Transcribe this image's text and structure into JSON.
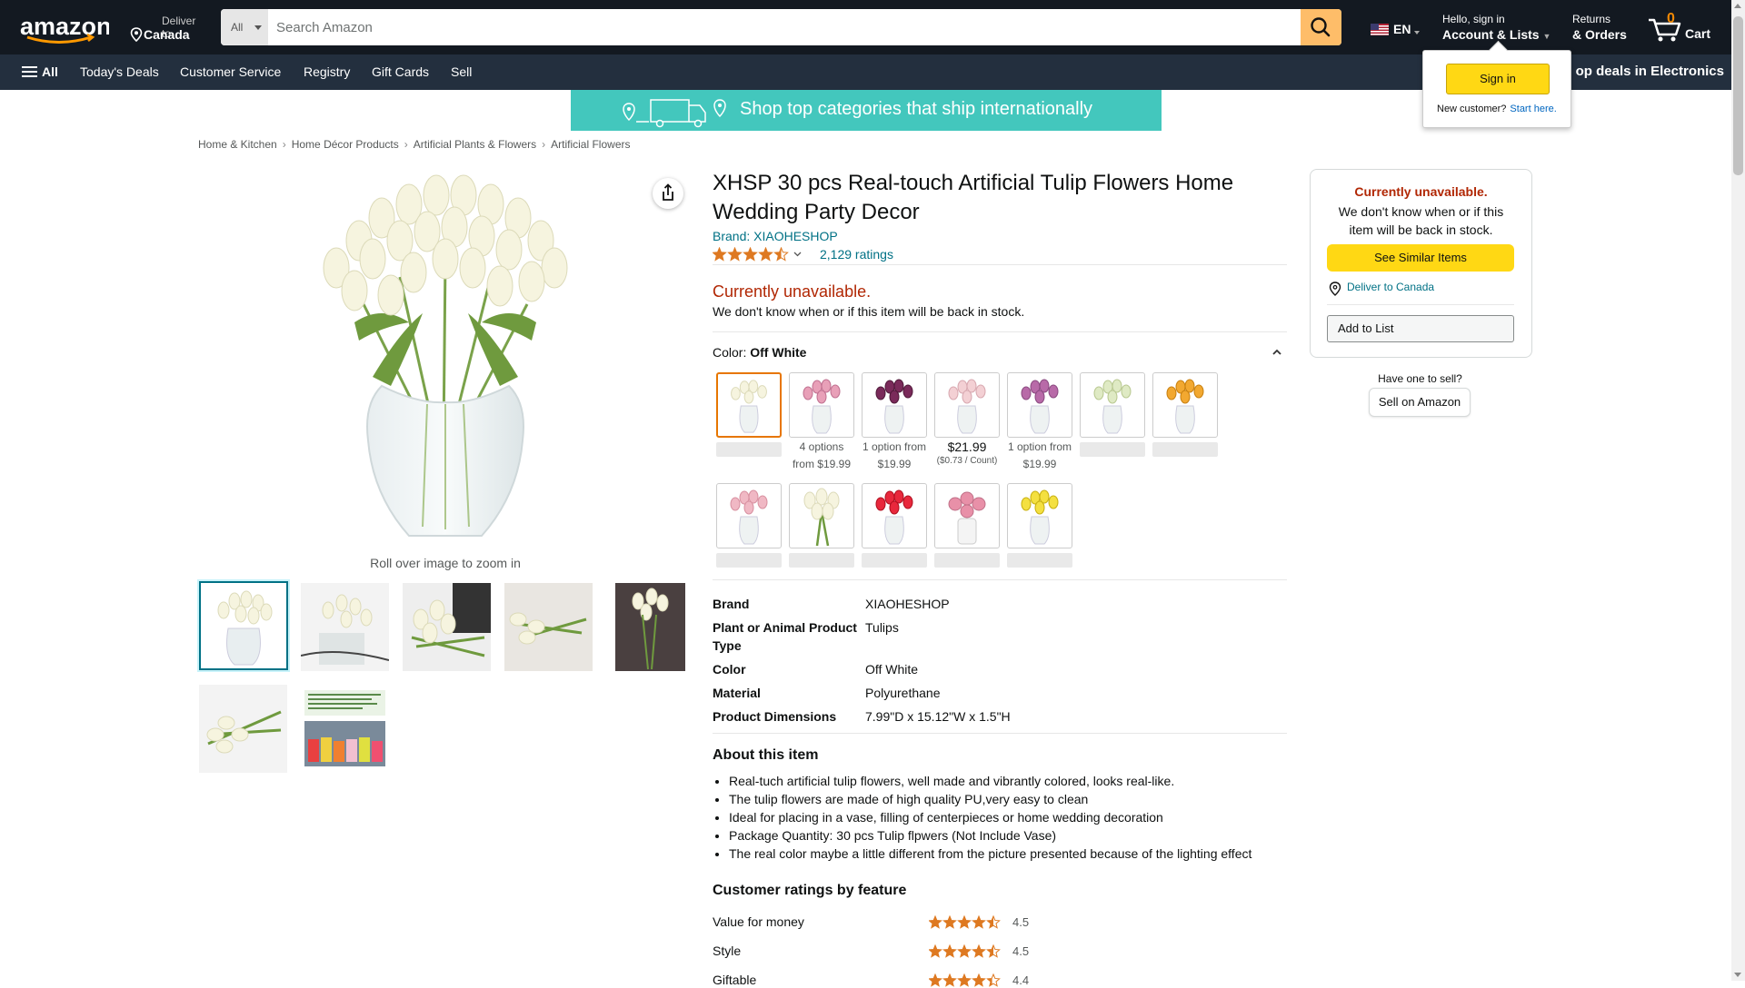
{
  "header": {
    "deliver_line1": "Deliver to",
    "deliver_line2": "Canada",
    "search_category": "All",
    "search_placeholder": "Search Amazon",
    "language": "EN",
    "account_line1": "Hello, sign in",
    "account_line2": "Account & Lists",
    "returns_line1": "Returns",
    "returns_line2": "& Orders",
    "cart_count": "0",
    "cart_label": "Cart"
  },
  "subnav": {
    "all": "All",
    "items": [
      "Today's Deals",
      "Customer Service",
      "Registry",
      "Gift Cards",
      "Sell"
    ],
    "promo": "op deals in Electronics"
  },
  "signin_flyout": {
    "button": "Sign in",
    "new_customer": "New customer?",
    "start_here": "Start here."
  },
  "banner": {
    "text": "Shop top categories that ship internationally"
  },
  "breadcrumb": [
    "Home & Kitchen",
    "Home Décor Products",
    "Artificial Plants & Flowers",
    "Artificial Flowers"
  ],
  "gallery": {
    "rollover": "Roll over image to zoom in"
  },
  "product": {
    "title": "XHSP 30 pcs Real-touch Artificial Tulip Flowers Home Wedding Party Decor",
    "brand": "Brand: XIAOHESHOP",
    "rating": 4.5,
    "ratings_count": "2,129 ratings",
    "unavailable": "Currently unavailable.",
    "unavailable_note": "We don't know when or if this item will be back in stock.",
    "color_label": "Color:",
    "color_value": "Off White"
  },
  "swatches": {
    "captions": {
      "s2_a": "4 options",
      "s2_b": "from $19.99",
      "s3_a": "1 option from",
      "s3_b": "$19.99",
      "s4_price": "$21.99",
      "s4_unit": "($0.73 / Count)",
      "s5_a": "1 option from",
      "s5_b": "$19.99"
    }
  },
  "specs": [
    {
      "key": "Brand",
      "value": "XIAOHESHOP"
    },
    {
      "key": "Plant or Animal Product Type",
      "value": "Tulips"
    },
    {
      "key": "Color",
      "value": "Off White"
    },
    {
      "key": "Material",
      "value": "Polyurethane"
    },
    {
      "key": "Product Dimensions",
      "value": "7.99\"D x 15.12\"W x 1.5\"H"
    }
  ],
  "about": {
    "heading": "About this item",
    "bullets": [
      "Real-tuch artificial tulip flowers, well made and vibrantly colored, looks real-like.",
      "The tulip flowers are made of high quality PU,very easy to clean",
      "Ideal for placing in a vase, filling of centerpieces or home wedding decoration",
      "Package Quantity: 30 pcs Tulip flpwers (Not Include Vase)",
      "The real color maybe a little different from the picture presented because of the lighting effect"
    ]
  },
  "feature_ratings": {
    "heading": "Customer ratings by feature",
    "items": [
      {
        "name": "Value for money",
        "value": "4.5"
      },
      {
        "name": "Style",
        "value": "4.5"
      },
      {
        "name": "Giftable",
        "value": "4.4"
      }
    ]
  },
  "buybox": {
    "heading": "Currently unavailable.",
    "text": "We don't know when or if this item will be back in stock.",
    "similar": "See Similar Items",
    "deliver": "Deliver to Canada",
    "add_to_list": "Add to List"
  },
  "sell": {
    "have_one": "Have one to sell?",
    "button": "Sell on Amazon"
  },
  "colors": {
    "nav_dark": "#131921",
    "nav_sub": "#232f3e",
    "search_button": "#febd69",
    "cta_yellow": "#ffd814",
    "unavailable_red": "#B12704",
    "link_teal": "#007185",
    "banner_teal": "#43c7bd",
    "star_orange": "#de7921"
  }
}
